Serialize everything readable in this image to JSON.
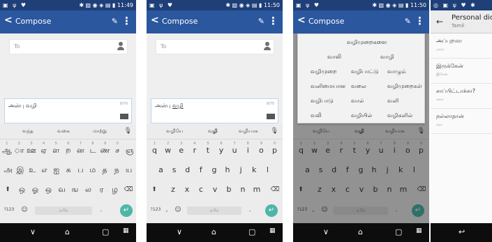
{
  "status": {
    "time1": "11:49",
    "time2": "11:50",
    "time3": "11:50"
  },
  "compose": {
    "title": "Compose",
    "to_placeholder": "To",
    "message": "அன்பு வழி",
    "message_link": "வழி",
    "counter": "9/70"
  },
  "kb_tamil": {
    "suggestions": [
      "வந்த",
      "வகை",
      "மாற்று"
    ],
    "row1": [
      "ஆ",
      "ா",
      "ஊ",
      "ஏ",
      "ள",
      "ற",
      "ன",
      "ட",
      "ண",
      "ச",
      "ஞ"
    ],
    "row1_nums": [
      "1",
      "2",
      "3",
      "4",
      "5",
      "6",
      "7",
      "8",
      "9",
      "0",
      ""
    ],
    "row2": [
      "அ",
      "இ",
      "உ",
      "எ",
      "ஐ",
      "க",
      "ப",
      "ம",
      "த",
      "ந",
      "ய"
    ],
    "row3": [
      "ஒ",
      "ஓ",
      "ஒ",
      "வ",
      "ங",
      "ல",
      "ர",
      "ழ"
    ]
  },
  "kb_eng": {
    "suggestions": [
      "வழியே",
      "வழி",
      "வழியாக"
    ],
    "row1": [
      "q",
      "w",
      "e",
      "r",
      "t",
      "y",
      "u",
      "i",
      "o",
      "p"
    ],
    "row1_nums": [
      "1",
      "2",
      "3",
      "4",
      "5",
      "6",
      "7",
      "8",
      "9",
      "0"
    ],
    "row2": [
      "a",
      "s",
      "d",
      "f",
      "g",
      "h",
      "j",
      "k",
      "l"
    ],
    "row3": [
      "z",
      "x",
      "c",
      "v",
      "b",
      "n",
      "m"
    ]
  },
  "kb_common": {
    "sym": "?123",
    "comma": ",",
    "period": ".",
    "space_label": "தமிழ்"
  },
  "popup": {
    "words": [
      "வழிமுறைகளை",
      "வாலி",
      "வாழி",
      "வழிமுறை",
      "வழிபாட்டு",
      "வாழும்",
      "வனிமையான",
      "வலை",
      "வழிமுறைகள்",
      "வழிபாடு",
      "வால்",
      "வளி",
      "வலி",
      "வழியில்",
      "வழிகளில்"
    ]
  },
  "dict": {
    "title": "Personal dic",
    "subtitle": "Tamil",
    "entries": [
      {
        "word": "அப்புறமா",
        "shortcut": "அறா"
      },
      {
        "word": "இருக்கேன்",
        "shortcut": "இகேன"
      },
      {
        "word": "சாப்பிட்டாச்சா?",
        "shortcut": "சச்சா"
      },
      {
        "word": "நல்லாதான்",
        "shortcut": "நதா"
      }
    ]
  },
  "icons": {
    "back": "arrow-left-icon",
    "attach": "paperclip-icon",
    "more": "more-vert-icon",
    "contact": "person-icon",
    "mic": "mic-icon",
    "backspace": "backspace-icon",
    "shift": "shift-icon",
    "enter": "enter-icon",
    "nav_back": "nav-back-icon",
    "nav_home": "nav-home-icon",
    "nav_recent": "nav-recent-icon",
    "keyboard": "keyboard-icon"
  }
}
